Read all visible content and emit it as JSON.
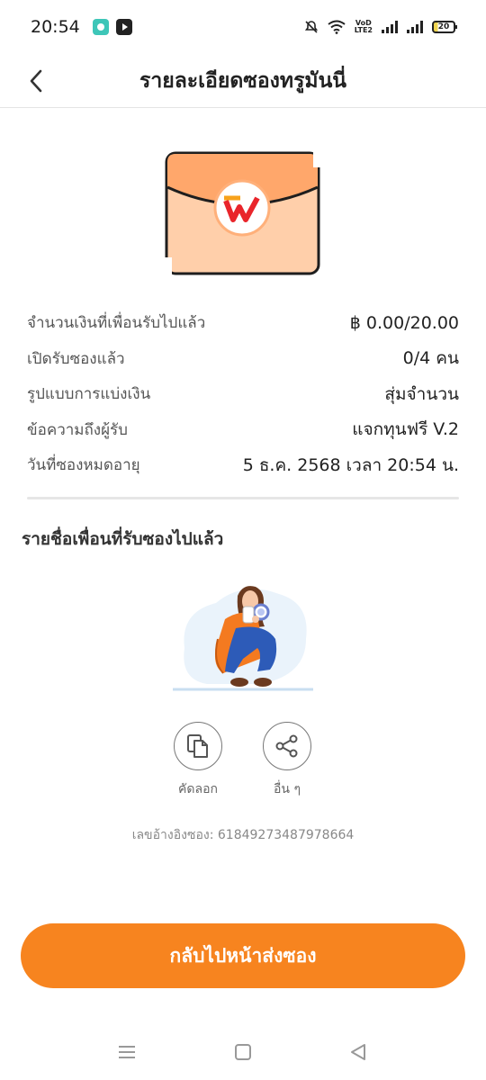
{
  "status_bar": {
    "time": "20:54",
    "network_label": "VoD LTE2",
    "battery": "20"
  },
  "header": {
    "title": "รายละเอียดซองทรูมันนี่"
  },
  "details": [
    {
      "label": "จำนวนเงินที่เพื่อนรับไปแล้ว",
      "value": "฿ 0.00/20.00"
    },
    {
      "label": "เปิดรับซองแล้ว",
      "value": "0/4 คน"
    },
    {
      "label": "รูปแบบการแบ่งเงิน",
      "value": "สุ่มจำนวน"
    },
    {
      "label": "ข้อความถึงผู้รับ",
      "value": "แจกทุนฟรี V.2"
    },
    {
      "label": "วันที่ซองหมดอายุ",
      "value": "5 ธ.ค. 2568 เวลา 20:54 น."
    }
  ],
  "recipients": {
    "title": "รายชื่อเพื่อนที่รับซองไปแล้ว"
  },
  "actions": {
    "copy_label": "คัดลอก",
    "share_label": "อื่น ๆ"
  },
  "reference": "เลขอ้างอิงซอง: 61849273487978664",
  "primary_button": "กลับไปหน้าส่งซอง",
  "colors": {
    "accent": "#F7841F",
    "envelope": "#FFC8A0"
  }
}
